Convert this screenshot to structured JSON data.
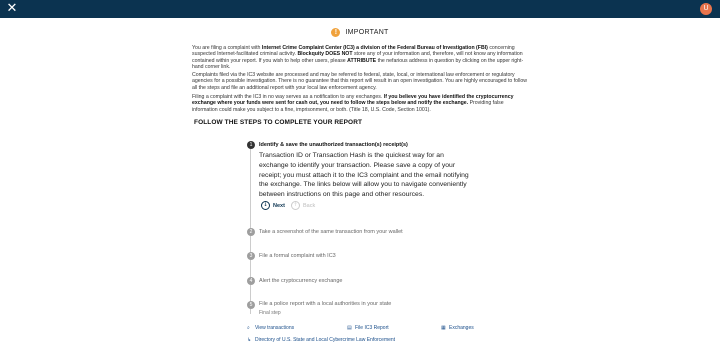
{
  "header": {
    "close_icon": "close-icon",
    "avatar_initial": "U"
  },
  "notice": {
    "title": "IMPORTANT",
    "p1_a": "You are filing a complaint with ",
    "p1_b": "Internet Crime Complaint Center (IC3) a division of the Federal Bureau of Investigation (FBI)",
    "p1_c": " concerning suspected Internet-facilitated criminal activity. ",
    "p1_d": "Blockquity",
    "p1_e": " ",
    "p1_f": "DOES NOT",
    "p1_g": " store any of your information and, therefore, will not know any information contained within your report. If you wish to help other users, please ",
    "p1_h": "ATTRIBUTE",
    "p1_i": " the nefarious address in question by clicking on the upper right-hand corner link.",
    "p2": "Complaints filed via the IC3 website are processed and may be referred to federal, state, local, or international law enforcement or regulatory agencies for a possible investigation. There is no guarantee that this report will result in an open investigation. You are highly encouraged to follow all the steps and file an additional report with your local law enforcement agency.",
    "p3_a": "Filing a complaint with the IC3 in no way serves as a notification to any exchanges. ",
    "p3_b": "If you believe you have identified the cryptocurrency exchange where your funds were sent for cash out, you need to follow the steps below and notify the exchange.",
    "p3_c": " Providing false information could make you subject to a fine, imprisonment, or both. (Title 18, U.S. Code, Section 1001)."
  },
  "steps_heading": "FOLLOW THE STEPS TO COMPLETE YOUR REPORT",
  "steps": [
    {
      "num": "1",
      "label": "Identify & save the unauthorized transaction(s) receipt(s)"
    },
    {
      "num": "2",
      "label": "Take a screenshot of the same transaction from your wallet"
    },
    {
      "num": "3",
      "label": "File a formal complaint with IC3"
    },
    {
      "num": "4",
      "label": "Alert the cryptocurrency exchange"
    },
    {
      "num": "5",
      "label": "File a police report with a local authorities in your state"
    }
  ],
  "active_step_body": "Transaction ID or Transaction Hash is the quickest way for an exchange to identify your transaction. Please save a copy of your receipt; you must attach it to the IC3 complaint and the email notifying the exchange. The links below will allow you to navigate conveniently between instructions on this page and other resources.",
  "final_step_label": "Final step",
  "buttons": {
    "next": "Next",
    "back": "Back"
  },
  "footer_links": {
    "view_transactions": "View transactions",
    "file_report": "File IC3 Report",
    "exchanges": "Exchanges",
    "directory": "Directory of U.S. State and Local Cybercrime Law Enforcement"
  },
  "colors": {
    "topbar": "#0b3350",
    "accent": "#1a4e8a",
    "warning": "#f0a23c"
  }
}
